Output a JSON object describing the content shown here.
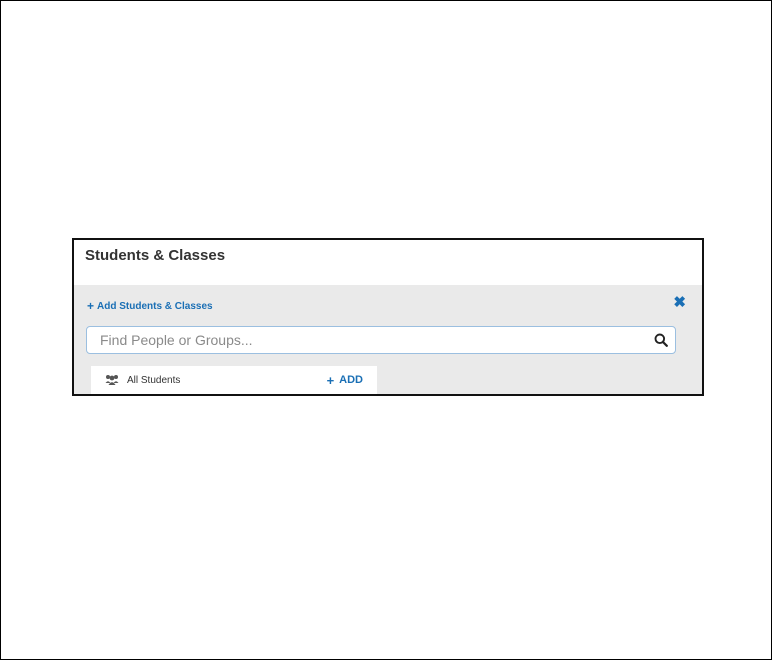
{
  "panel": {
    "title": "Students & Classes"
  },
  "add_link": {
    "icon": "plus-icon",
    "plus": "+",
    "label": "Add Students & Classes"
  },
  "close": {
    "icon": "close-icon",
    "glyph": "✖"
  },
  "search": {
    "placeholder": "Find People or Groups...",
    "value": "",
    "icon": "search-icon"
  },
  "results": [
    {
      "icon": "users-icon",
      "label": "All Students",
      "action_plus": "+",
      "action_label": "ADD"
    }
  ],
  "colors": {
    "accent": "#1a6fb5",
    "panel_body_bg": "#eaeaea",
    "title_text": "#333333"
  }
}
